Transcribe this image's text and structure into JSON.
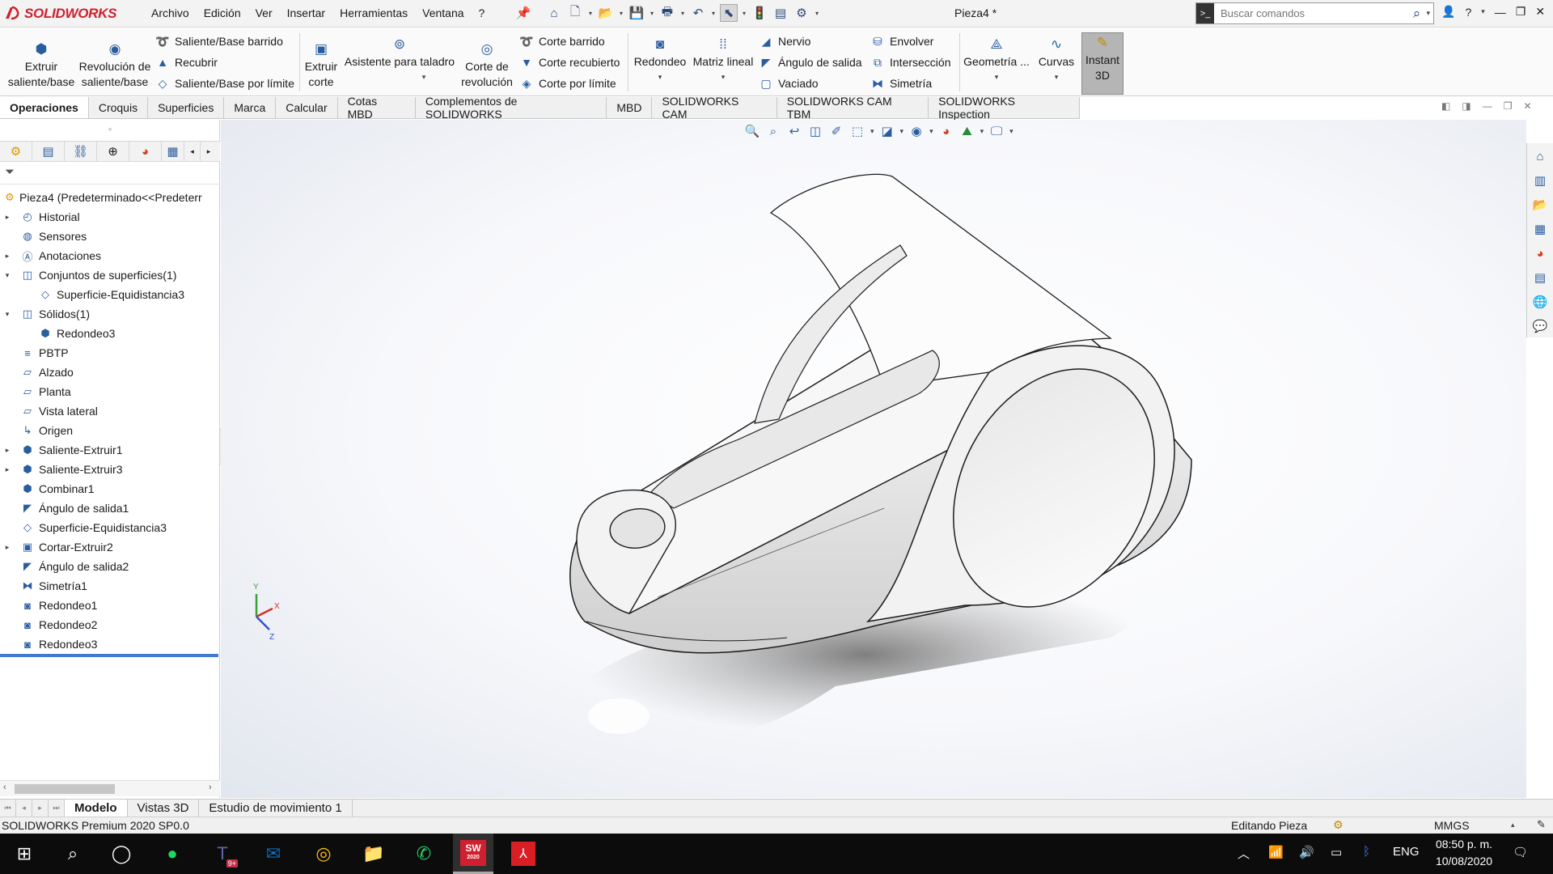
{
  "app": {
    "brand": "SOLIDWORKS",
    "document_title": "Pieza4 *"
  },
  "menu": [
    "Archivo",
    "Edición",
    "Ver",
    "Insertar",
    "Herramientas",
    "Ventana",
    "?"
  ],
  "search": {
    "placeholder": "Buscar comandos"
  },
  "toolbar": {
    "extrude_boss": "Extruir\nsaliente/base",
    "revolve_boss": "Revolución de\nsaliente/base",
    "swept_boss": "Saliente/Base barrido",
    "loft": "Recubrir",
    "boundary_boss": "Saliente/Base por límite",
    "extrude_cut": "Extruir\ncorte",
    "hole_wizard": "Asistente para taladro",
    "revolve_cut": "Corte de\nrevolución",
    "swept_cut": "Corte barrido",
    "lofted_cut": "Corte recubierto",
    "boundary_cut": "Corte por límite",
    "fillet": "Redondeo",
    "linear_pattern": "Matriz lineal",
    "rib": "Nervio",
    "draft": "Ángulo de salida",
    "shell": "Vaciado",
    "wrap": "Envolver",
    "intersect": "Intersección",
    "mirror": "Simetría",
    "geometry": "Geometría ...",
    "curves": "Curvas",
    "instant3d": "Instant\n3D"
  },
  "tabs": [
    "Operaciones",
    "Croquis",
    "Superficies",
    "Marca",
    "Calcular",
    "Cotas MBD",
    "Complementos de SOLIDWORKS",
    "MBD",
    "SOLIDWORKS CAM",
    "SOLIDWORKS CAM TBM",
    "SOLIDWORKS Inspection"
  ],
  "feature_tree": {
    "root": "Pieza4  (Predeterminado<<Predeterr",
    "items": [
      {
        "label": "Historial",
        "icon": "history-icon",
        "expander": "▸",
        "indent": 0
      },
      {
        "label": "Sensores",
        "icon": "sensors-icon",
        "expander": "",
        "indent": 0
      },
      {
        "label": "Anotaciones",
        "icon": "annotations-icon",
        "expander": "▸",
        "indent": 0
      },
      {
        "label": "Conjuntos de superficies(1)",
        "icon": "surface-bodies-icon",
        "expander": "▾",
        "indent": 0
      },
      {
        "label": "Superficie-Equidistancia3",
        "icon": "offset-surface-icon",
        "expander": "",
        "indent": 1
      },
      {
        "label": "Sólidos(1)",
        "icon": "solid-bodies-icon",
        "expander": "▾",
        "indent": 0
      },
      {
        "label": "Redondeo3",
        "icon": "solid-body-icon",
        "expander": "",
        "indent": 1
      },
      {
        "label": "PBTP",
        "icon": "material-icon",
        "expander": "",
        "indent": 0
      },
      {
        "label": "Alzado",
        "icon": "plane-icon",
        "expander": "",
        "indent": 0
      },
      {
        "label": "Planta",
        "icon": "plane-icon",
        "expander": "",
        "indent": 0
      },
      {
        "label": "Vista lateral",
        "icon": "plane-icon",
        "expander": "",
        "indent": 0
      },
      {
        "label": "Origen",
        "icon": "origin-icon",
        "expander": "",
        "indent": 0
      },
      {
        "label": "Saliente-Extruir1",
        "icon": "extrude-icon",
        "expander": "▸",
        "indent": 0
      },
      {
        "label": "Saliente-Extruir3",
        "icon": "extrude-icon",
        "expander": "▸",
        "indent": 0
      },
      {
        "label": "Combinar1",
        "icon": "combine-icon",
        "expander": "",
        "indent": 0
      },
      {
        "label": "Ángulo de salida1",
        "icon": "draft-icon",
        "expander": "",
        "indent": 0
      },
      {
        "label": "Superficie-Equidistancia3",
        "icon": "offset-surface-icon",
        "expander": "",
        "indent": 0
      },
      {
        "label": "Cortar-Extruir2",
        "icon": "cut-extrude-icon",
        "expander": "▸",
        "indent": 0
      },
      {
        "label": "Ángulo de salida2",
        "icon": "draft-icon",
        "expander": "",
        "indent": 0
      },
      {
        "label": "Simetría1",
        "icon": "mirror-icon",
        "expander": "",
        "indent": 0
      },
      {
        "label": "Redondeo1",
        "icon": "fillet-icon",
        "expander": "",
        "indent": 0
      },
      {
        "label": "Redondeo2",
        "icon": "fillet-icon",
        "expander": "",
        "indent": 0
      },
      {
        "label": "Redondeo3",
        "icon": "fillet-icon",
        "expander": "",
        "indent": 0
      }
    ]
  },
  "triad": {
    "x": "X",
    "y": "Y",
    "z": "Z"
  },
  "bottom_tabs": [
    "Modelo",
    "Vistas 3D",
    "Estudio de movimiento 1"
  ],
  "status": {
    "product": "SOLIDWORKS Premium 2020 SP0.0",
    "mode": "Editando Pieza",
    "units": "MMGS"
  },
  "taskbar": {
    "language": "ENG",
    "time": "08:50 p. m.",
    "date": "10/08/2020",
    "teams_badge": "9+",
    "sw_badge": "2020"
  }
}
